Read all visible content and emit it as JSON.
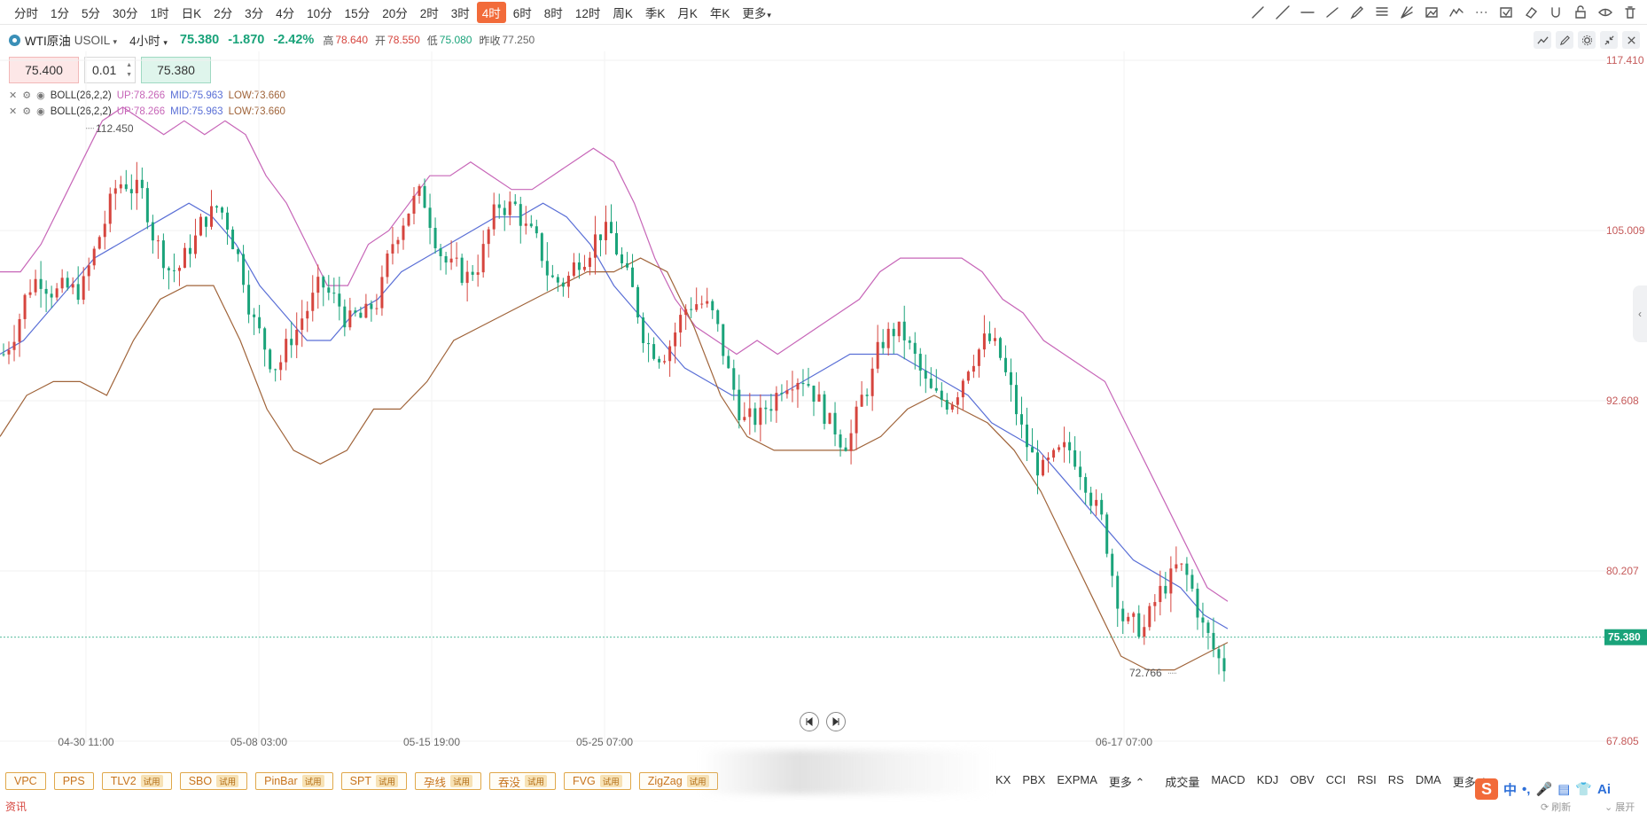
{
  "timeframes": [
    {
      "label": "分时",
      "active": false
    },
    {
      "label": "1分",
      "active": false
    },
    {
      "label": "5分",
      "active": false
    },
    {
      "label": "30分",
      "active": false
    },
    {
      "label": "1时",
      "active": false
    },
    {
      "label": "日K",
      "active": false
    },
    {
      "label": "2分",
      "active": false
    },
    {
      "label": "3分",
      "active": false
    },
    {
      "label": "4分",
      "active": false
    },
    {
      "label": "10分",
      "active": false
    },
    {
      "label": "15分",
      "active": false
    },
    {
      "label": "20分",
      "active": false
    },
    {
      "label": "2时",
      "active": false
    },
    {
      "label": "3时",
      "active": false
    },
    {
      "label": "4时",
      "active": true
    },
    {
      "label": "6时",
      "active": false
    },
    {
      "label": "8时",
      "active": false
    },
    {
      "label": "12时",
      "active": false
    },
    {
      "label": "周K",
      "active": false
    },
    {
      "label": "季K",
      "active": false
    },
    {
      "label": "月K",
      "active": false
    },
    {
      "label": "年K",
      "active": false
    },
    {
      "label": "更多",
      "active": false
    }
  ],
  "draw_tools": [
    "ray-line-icon",
    "extended-line-icon",
    "horizontal-line-icon",
    "trend-line-icon",
    "pen-icon",
    "fib-icon",
    "fan-icon",
    "image-icon",
    "wave-icon",
    "more-dots-icon",
    "snapshot-icon",
    "eraser-icon",
    "magnet-icon",
    "lock-icon",
    "eye-icon",
    "trash-icon"
  ],
  "symbol": {
    "name": "WTI原油",
    "code": "USOIL",
    "period": "4小时",
    "price": "75.380",
    "change": "-1.870",
    "change_pct": "-2.42%",
    "high_label": "高",
    "high": "78.640",
    "open_label": "开",
    "open": "78.550",
    "low_label": "低",
    "low": "75.080",
    "prev_label": "昨收",
    "prev": "77.250"
  },
  "ticket": {
    "sell_price": "75.400",
    "quantity": "0.01",
    "buy_price": "75.380"
  },
  "legends": [
    {
      "name": "BOLL(26,2,2)",
      "up": "UP:78.266",
      "mid": "MID:75.963",
      "low": "LOW:73.660"
    },
    {
      "name": "BOLL(26,2,2)",
      "up": "UP:78.266",
      "mid": "MID:75.963",
      "low": "LOW:73.660"
    }
  ],
  "chart_data": {
    "type": "candlestick",
    "y_ticks": [
      "117.410",
      "105.009",
      "92.608",
      "80.207",
      "67.805"
    ],
    "ylim": [
      67.805,
      117.41
    ],
    "x_ticks": [
      "04-30 11:00",
      "05-08 03:00",
      "05-15 19:00",
      "05-25 07:00",
      "06-17 07:00"
    ],
    "current_price": "75.380",
    "max_label": "112.450",
    "min_label": "72.766",
    "indicator": "BOLL(26,2,2)",
    "colors": {
      "up": "#d6453e",
      "down": "#1aa37a",
      "upper": "#c766b8",
      "mid": "#5a6fd6",
      "lower": "#a0643a"
    },
    "series": [
      {
        "name": "UP",
        "values": [
          102,
          102,
          104,
          107,
          110,
          113,
          114,
          113,
          112,
          113,
          112,
          113,
          112,
          109,
          107,
          104,
          101,
          101,
          104,
          105,
          107,
          109,
          109,
          110,
          109,
          108,
          108,
          109,
          110,
          111,
          110,
          107,
          103,
          100,
          98,
          97,
          96,
          97,
          96,
          97,
          98,
          99,
          100,
          102,
          103,
          103,
          103,
          103,
          102,
          100,
          99,
          97,
          96,
          95,
          94,
          91,
          88,
          85,
          82,
          79,
          78
        ]
      },
      {
        "name": "MID",
        "values": [
          96,
          97,
          99,
          101,
          103,
          104,
          105,
          106,
          107,
          106,
          104,
          101,
          99,
          97,
          97,
          99,
          100,
          102,
          103,
          104,
          105,
          106,
          106,
          107,
          106,
          104,
          101,
          99,
          97,
          95,
          94,
          93,
          93,
          93,
          94,
          95,
          96,
          96,
          96,
          95,
          94,
          93,
          91,
          90,
          89,
          87,
          85,
          83,
          81,
          80,
          79,
          77,
          76
        ]
      },
      {
        "name": "LOW",
        "values": [
          90,
          93,
          94,
          94,
          93,
          97,
          100,
          101,
          101,
          97,
          92,
          89,
          88,
          89,
          92,
          92,
          94,
          97,
          98,
          99,
          100,
          101,
          102,
          102,
          103,
          102,
          98,
          93,
          90,
          89,
          89,
          89,
          89,
          90,
          92,
          93,
          92,
          91,
          89,
          86,
          82,
          78,
          74,
          73,
          73,
          74,
          75
        ]
      }
    ]
  }
}
